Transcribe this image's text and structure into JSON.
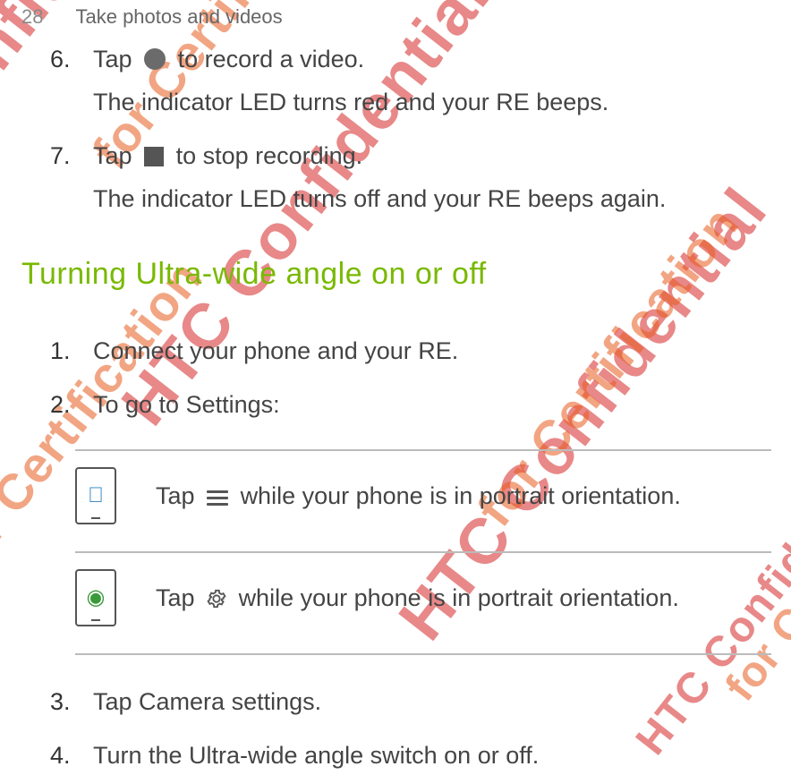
{
  "header": {
    "page_number": "28",
    "chapter": "Take photos and videos"
  },
  "intro_steps": [
    {
      "num": "6.",
      "pre": "Tap ",
      "icon": "record-circle",
      "post": " to record a video.",
      "sub": "The indicator LED turns red and your RE beeps."
    },
    {
      "num": "7.",
      "pre": "Tap ",
      "icon": "stop-square",
      "post": " to stop recording.",
      "sub": "The indicator LED turns off and your RE beeps again."
    }
  ],
  "section_heading": "Turning Ultra-wide angle on or off",
  "ultra_wide_steps": {
    "s1": {
      "num": "1.",
      "text": "Connect your phone and your RE."
    },
    "s2": {
      "num": "2.",
      "text": "To go to Settings:"
    },
    "table": [
      {
        "platform": "ios",
        "pre": "Tap ",
        "icon": "menu-3-lines",
        "post": " while your phone is in portrait orientation."
      },
      {
        "platform": "android",
        "pre": "Tap ",
        "icon": "gear",
        "post": " while your phone is in portrait orientation."
      }
    ],
    "s3": {
      "num": "3.",
      "text": "Tap Camera settings."
    },
    "s4": {
      "num": "4.",
      "text": "Turn the Ultra-wide angle switch on or off."
    }
  },
  "watermarks": {
    "confidential": "HTC Confidential",
    "certification": "for Certification"
  }
}
